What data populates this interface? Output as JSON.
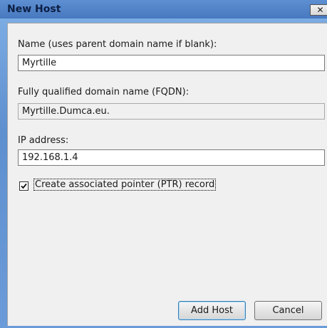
{
  "window": {
    "title": "New Host",
    "close_glyph": "✕"
  },
  "form": {
    "name_label": "Name (uses parent domain name if blank):",
    "name_value": "Myrtille",
    "fqdn_label": "Fully qualified domain name (FQDN):",
    "fqdn_value": "Myrtille.Dumca.eu.",
    "ip_label": "IP address:",
    "ip_value": "192.168.1.4",
    "ptr_label": "Create associated pointer (PTR) record",
    "ptr_checked": true
  },
  "buttons": {
    "add_host": "Add Host",
    "cancel": "Cancel"
  }
}
